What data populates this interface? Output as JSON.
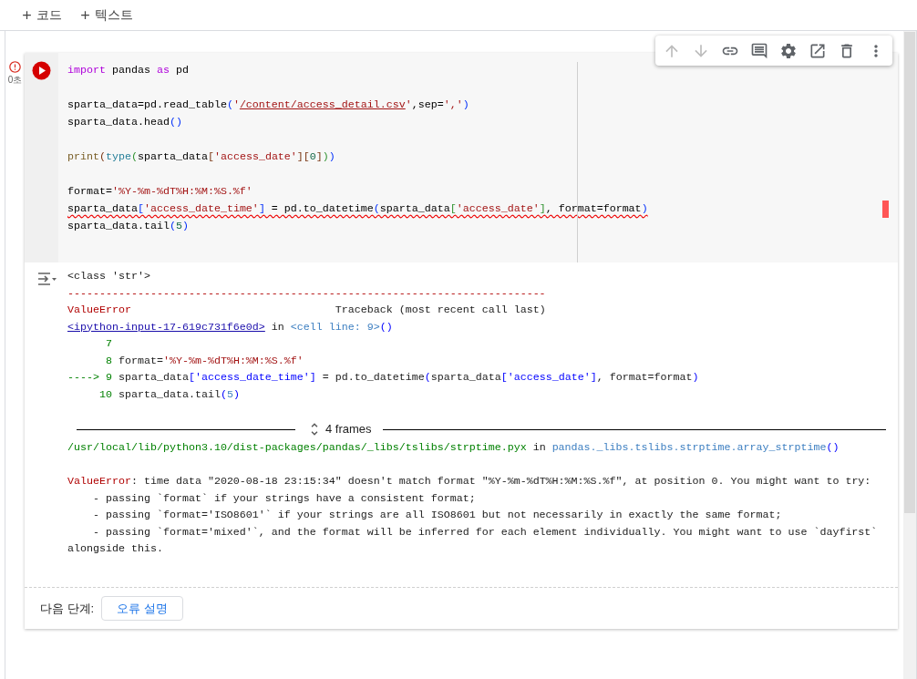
{
  "top_bar": {
    "add_buttons": [
      {
        "label": "코드"
      },
      {
        "label": "텍스트"
      }
    ]
  },
  "cell": {
    "error": true,
    "exec_time": "0초",
    "toolbar": [
      {
        "kind": "move-up",
        "disabled": true
      },
      {
        "kind": "move-down",
        "disabled": true
      },
      {
        "kind": "link",
        "disabled": false
      },
      {
        "kind": "comment",
        "disabled": false
      },
      {
        "kind": "settings",
        "disabled": false
      },
      {
        "kind": "mirror",
        "disabled": false
      },
      {
        "kind": "delete",
        "disabled": false
      },
      {
        "kind": "more",
        "disabled": false
      }
    ],
    "code_lines": [
      {
        "tokens": [
          {
            "text": "import",
            "kind": "keyword"
          },
          {
            "text": " pandas ",
            "kind": "plain"
          },
          {
            "text": "as",
            "kind": "keyword"
          },
          {
            "text": " pd",
            "kind": "plain"
          }
        ]
      },
      {
        "blank_before": true,
        "tokens": [
          {
            "text": "sparta_data=pd.read_table",
            "kind": "plain"
          },
          {
            "text": "(",
            "kind": "b1"
          },
          {
            "text": "'",
            "kind": "string"
          },
          {
            "text": "/content/access_detail.csv",
            "kind": "string-link"
          },
          {
            "text": "'",
            "kind": "string"
          },
          {
            "text": ",sep=",
            "kind": "plain"
          },
          {
            "text": "','",
            "kind": "string"
          },
          {
            "text": ")",
            "kind": "b1"
          }
        ]
      },
      {
        "tokens": [
          {
            "text": "sparta_data.head",
            "kind": "plain"
          },
          {
            "text": "()",
            "kind": "b1"
          }
        ]
      },
      {
        "blank_before": true,
        "tokens": [
          {
            "text": "print",
            "kind": "func"
          },
          {
            "text": "(",
            "kind": "b3"
          },
          {
            "text": "type",
            "kind": "builtin"
          },
          {
            "text": "(",
            "kind": "b2"
          },
          {
            "text": "sparta_data",
            "kind": "plain"
          },
          {
            "text": "[",
            "kind": "b3"
          },
          {
            "text": "'access_date'",
            "kind": "string"
          },
          {
            "text": "][",
            "kind": "b3"
          },
          {
            "text": "0",
            "kind": "number"
          },
          {
            "text": "]",
            "kind": "b3"
          },
          {
            "text": ")",
            "kind": "b2"
          },
          {
            "text": ")",
            "kind": "b1"
          }
        ]
      },
      {
        "blank_before": true,
        "tokens": [
          {
            "text": "format=",
            "kind": "plain"
          },
          {
            "text": "'%Y-%m-%dT%H:%M:%S.%f'",
            "kind": "string"
          }
        ]
      },
      {
        "error": true,
        "tokens": [
          {
            "text": "sparta_data",
            "kind": "plain"
          },
          {
            "text": "[",
            "kind": "b1"
          },
          {
            "text": "'access_date_time'",
            "kind": "string"
          },
          {
            "text": "]",
            "kind": "b1"
          },
          {
            "text": " = pd.to_datetime",
            "kind": "plain"
          },
          {
            "text": "(",
            "kind": "b1"
          },
          {
            "text": "sparta_data",
            "kind": "plain"
          },
          {
            "text": "[",
            "kind": "b2"
          },
          {
            "text": "'access_date'",
            "kind": "string"
          },
          {
            "text": "]",
            "kind": "b2"
          },
          {
            "text": ", format=format",
            "kind": "plain"
          },
          {
            "text": ")",
            "kind": "b1"
          }
        ]
      },
      {
        "tokens": [
          {
            "text": "sparta_data.tail",
            "kind": "plain"
          },
          {
            "text": "(",
            "kind": "b1"
          },
          {
            "text": "5",
            "kind": "number"
          },
          {
            "text": ")",
            "kind": "b1"
          }
        ]
      }
    ],
    "output": [
      {
        "kind": "line",
        "tokens": [
          {
            "text": "<class 'str'>",
            "kind": "plain"
          }
        ]
      },
      {
        "kind": "line",
        "tokens": [
          {
            "text": "---------------------------------------------------------------------------",
            "kind": "error"
          }
        ]
      },
      {
        "kind": "line",
        "tokens": [
          {
            "text": "ValueError",
            "kind": "error"
          },
          {
            "text": "                                Traceback (most recent call last)",
            "kind": "plain"
          }
        ]
      },
      {
        "kind": "line",
        "tokens": [
          {
            "text": "<ipython-input-17-619c731f6e0d>",
            "kind": "link"
          },
          {
            "text": " in ",
            "kind": "plain"
          },
          {
            "text": "<cell line: 9>",
            "kind": "ref"
          },
          {
            "text": "()",
            "kind": "blue"
          }
        ]
      },
      {
        "kind": "line",
        "tokens": [
          {
            "text": "      7",
            "kind": "green"
          }
        ]
      },
      {
        "kind": "line",
        "tokens": [
          {
            "text": "      8",
            "kind": "green"
          },
          {
            "text": " format=",
            "kind": "plain"
          },
          {
            "text": "'%Y-%m-%dT%H:%M:%S.%f'",
            "kind": "string"
          }
        ]
      },
      {
        "kind": "line",
        "tokens": [
          {
            "text": "----> 9",
            "kind": "green"
          },
          {
            "text": " sparta_data",
            "kind": "plain"
          },
          {
            "text": "[",
            "kind": "blue"
          },
          {
            "text": "'access_date_time'",
            "kind": "blue"
          },
          {
            "text": "]",
            "kind": "blue"
          },
          {
            "text": " = pd.to_datetime",
            "kind": "plain"
          },
          {
            "text": "(",
            "kind": "blue"
          },
          {
            "text": "sparta_data",
            "kind": "plain"
          },
          {
            "text": "[",
            "kind": "blue"
          },
          {
            "text": "'access_date'",
            "kind": "blue"
          },
          {
            "text": "]",
            "kind": "blue"
          },
          {
            "text": ", format=format",
            "kind": "plain"
          },
          {
            "text": ")",
            "kind": "blue"
          }
        ]
      },
      {
        "kind": "line",
        "tokens": [
          {
            "text": "     10",
            "kind": "green"
          },
          {
            "text": " sparta_data.tail",
            "kind": "plain"
          },
          {
            "text": "(",
            "kind": "blue"
          },
          {
            "text": "5",
            "kind": "ref"
          },
          {
            "text": ")",
            "kind": "blue"
          }
        ]
      },
      {
        "kind": "frames",
        "label": "4 frames"
      },
      {
        "kind": "line",
        "tokens": [
          {
            "text": "/usr/local/lib/python3.10/dist-packages/pandas/_libs/tslibs/strptime.pyx",
            "kind": "green"
          },
          {
            "text": " in ",
            "kind": "plain"
          },
          {
            "text": "pandas._libs.tslibs.strptime.array_strptime",
            "kind": "ref"
          },
          {
            "text": "()",
            "kind": "blue"
          }
        ]
      },
      {
        "kind": "line",
        "blank_before": true,
        "tokens": [
          {
            "text": "ValueError",
            "kind": "error"
          },
          {
            "text": ": time data \"2020-08-18 23:15:34\" doesn't match format \"%Y-%m-%dT%H:%M:%S.%f\", at position 0. You might want to try:",
            "kind": "plain"
          }
        ]
      },
      {
        "kind": "line",
        "tokens": [
          {
            "text": "    - passing `format` if your strings have a consistent format;",
            "kind": "plain"
          }
        ]
      },
      {
        "kind": "line",
        "tokens": [
          {
            "text": "    - passing `format='ISO8601'` if your strings are all ISO8601 but not necessarily in exactly the same format;",
            "kind": "plain"
          }
        ]
      },
      {
        "kind": "line",
        "tokens": [
          {
            "text": "    - passing `format='mixed'`, and the format will be inferred for each element individually. You might want to use `dayfirst`",
            "kind": "plain"
          }
        ]
      },
      {
        "kind": "line",
        "tokens": [
          {
            "text": "alongside this.",
            "kind": "plain"
          }
        ]
      }
    ],
    "next_steps": {
      "label": "다음 단계:",
      "button": "오류 설명"
    }
  }
}
